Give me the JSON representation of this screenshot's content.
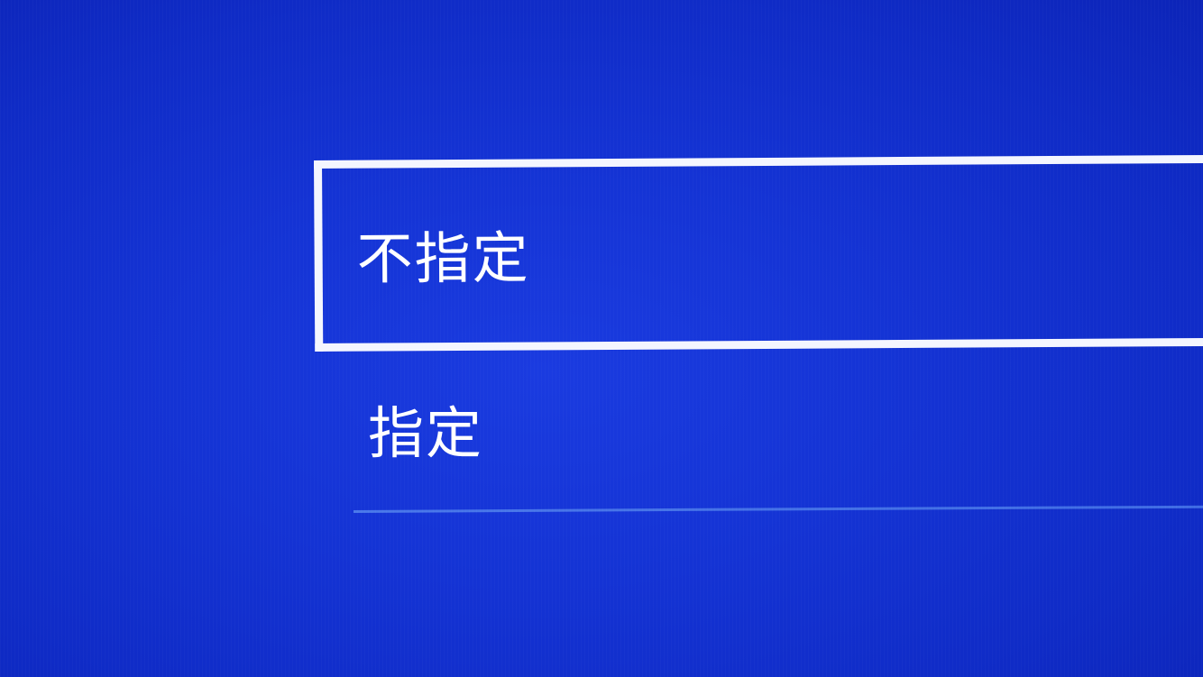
{
  "menu": {
    "options": [
      {
        "label": "不指定",
        "selected": true
      },
      {
        "label": "指定",
        "selected": false
      }
    ]
  },
  "colors": {
    "background": "#1433d4",
    "text": "#ffffff",
    "focus_border": "#f4f6ff",
    "divider": "#4a78ea"
  }
}
